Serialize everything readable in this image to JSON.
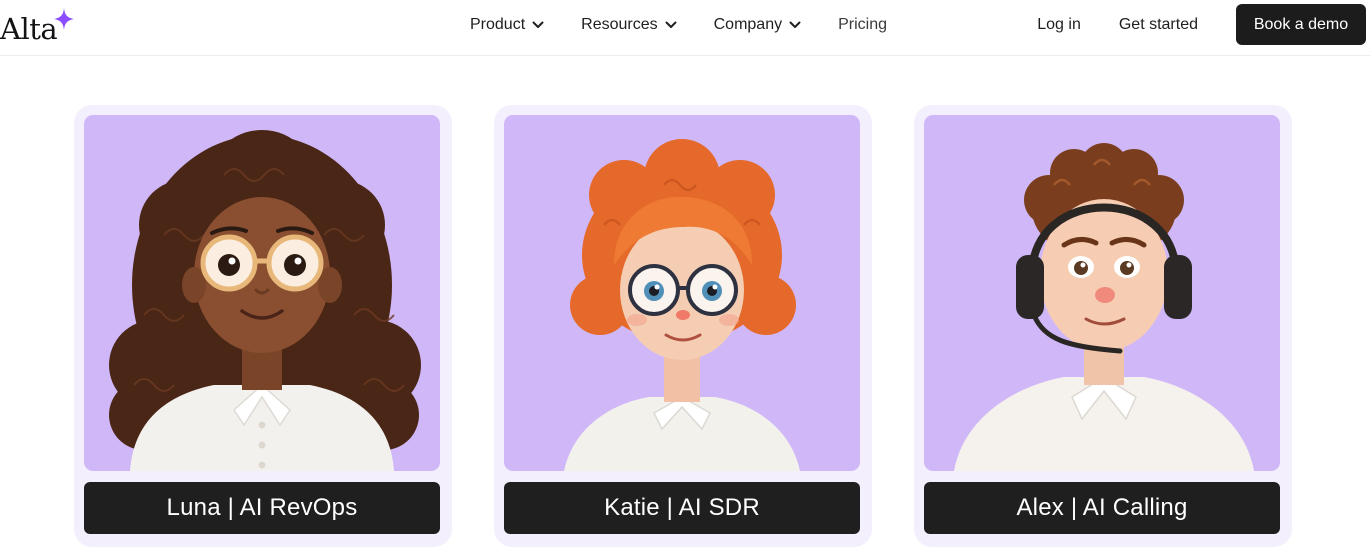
{
  "brand": {
    "name": "Alta",
    "accent": "#8b4dff"
  },
  "nav": [
    {
      "label": "Product",
      "has_menu": true
    },
    {
      "label": "Resources",
      "has_menu": true
    },
    {
      "label": "Company",
      "has_menu": true
    },
    {
      "label": "Pricing",
      "has_menu": false
    }
  ],
  "actions": {
    "login": "Log in",
    "get_started": "Get started",
    "book_demo": "Book a demo"
  },
  "cards": [
    {
      "label": "Luna | AI RevOps",
      "avatar": "luna-avatar-illustration",
      "bg": "#d0b8f8"
    },
    {
      "label": "Katie | AI SDR",
      "avatar": "katie-avatar-illustration",
      "bg": "#d0b8f8"
    },
    {
      "label": "Alex | AI Calling",
      "avatar": "alex-avatar-illustration",
      "bg": "#d0b8f8"
    }
  ]
}
